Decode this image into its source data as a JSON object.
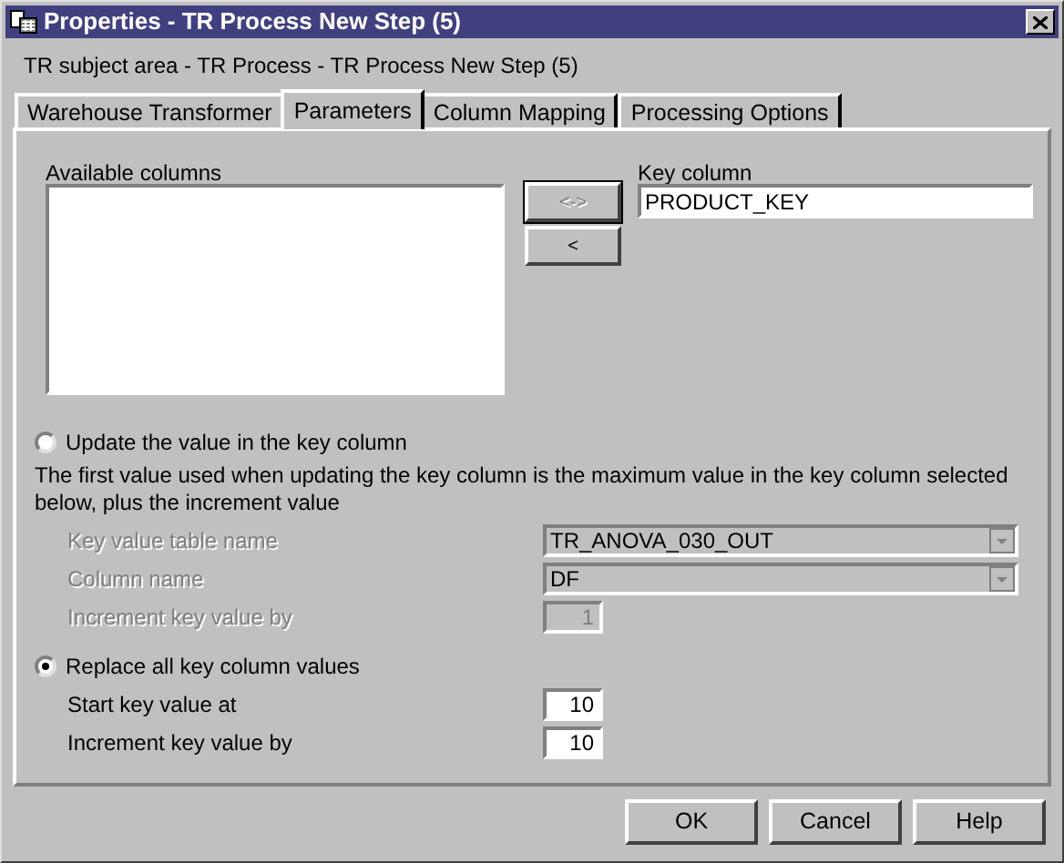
{
  "window": {
    "title": "Properties - TR Process New Step (5)"
  },
  "breadcrumb": "TR subject area - TR Process - TR Process New Step (5)",
  "tabs": [
    {
      "label": "Warehouse Transformer",
      "selected": false
    },
    {
      "label": "Parameters",
      "selected": true
    },
    {
      "label": "Column Mapping",
      "selected": false
    },
    {
      "label": "Processing Options",
      "selected": false
    }
  ],
  "available_columns": {
    "label": "Available columns"
  },
  "move_buttons": [
    {
      "label": "<->",
      "disabled": true
    },
    {
      "label": "<",
      "disabled": false
    }
  ],
  "key_column": {
    "label": "Key column",
    "value": "PRODUCT_KEY"
  },
  "options": [
    {
      "label": "Update the value in the key column",
      "selected": false,
      "description": "The first value used when updating the key column is the maximum value in the key column selected below, plus the increment value",
      "fields": [
        {
          "kind": "dropdown",
          "label": "Key value table name",
          "value": "TR_ANOVA_030_OUT",
          "disabled": true
        },
        {
          "kind": "dropdown",
          "label": "Column name",
          "value": "DF",
          "disabled": true
        },
        {
          "kind": "number",
          "label": "Increment key value by",
          "value": "1",
          "disabled": true
        }
      ]
    },
    {
      "label": "Replace all key column values",
      "selected": true,
      "fields": [
        {
          "kind": "number",
          "label": "Start key value at",
          "value": "10",
          "disabled": false
        },
        {
          "kind": "number",
          "label": "Increment key value by",
          "value": "10",
          "disabled": false
        }
      ]
    }
  ],
  "buttons": [
    "OK",
    "Cancel",
    "Help"
  ]
}
